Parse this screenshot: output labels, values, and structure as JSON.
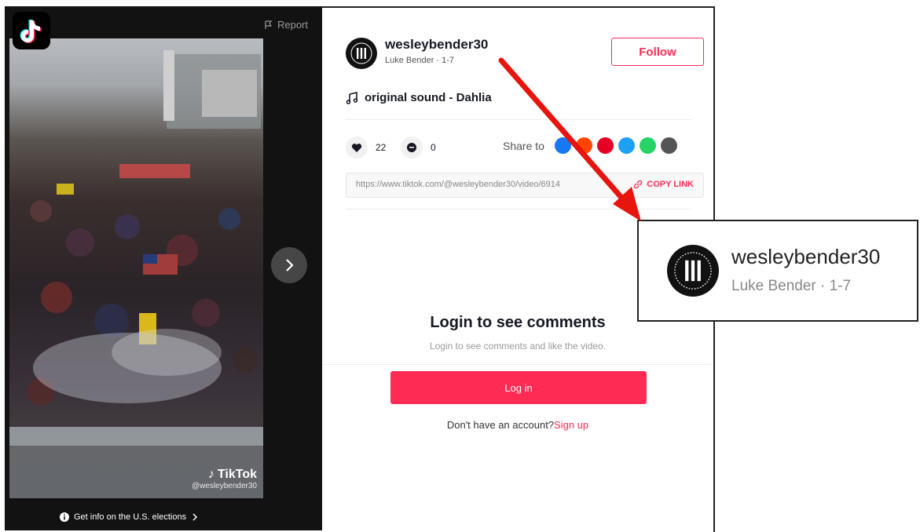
{
  "video": {
    "report_label": "Report",
    "watermark_brand": "TikTok",
    "watermark_handle": "@wesleybender30",
    "election_info": "Get info on the U.S. elections"
  },
  "author": {
    "username": "wesleybender30",
    "subline": "Luke Bender · 1-7",
    "avatar_text": "III"
  },
  "follow_label": "Follow",
  "sound": "original sound - Dahlia",
  "stats": {
    "likes": "22",
    "comments": "0"
  },
  "share": {
    "label": "Share to",
    "icons": [
      "facebook-icon",
      "reddit-icon",
      "pinterest-icon",
      "twitter-icon",
      "whatsapp-icon",
      "embed-icon"
    ],
    "colors": [
      "#1877f2",
      "#ff4500",
      "#e60023",
      "#1da1f2",
      "#25d366",
      "#555555"
    ]
  },
  "link": {
    "url": "https://www.tiktok.com/@wesleybender30/video/6914",
    "copy_label": "COPY LINK"
  },
  "login": {
    "title": "Login to see comments",
    "subtitle": "Login to see comments and like the video.",
    "button": "Log in",
    "no_account": "Don't have an account?",
    "signup": "Sign up"
  },
  "callout": {
    "username": "wesleybender30",
    "subline": "Luke Bender · 1-7"
  },
  "colors": {
    "accent": "#fe2c55",
    "arrow": "#e8140e"
  }
}
